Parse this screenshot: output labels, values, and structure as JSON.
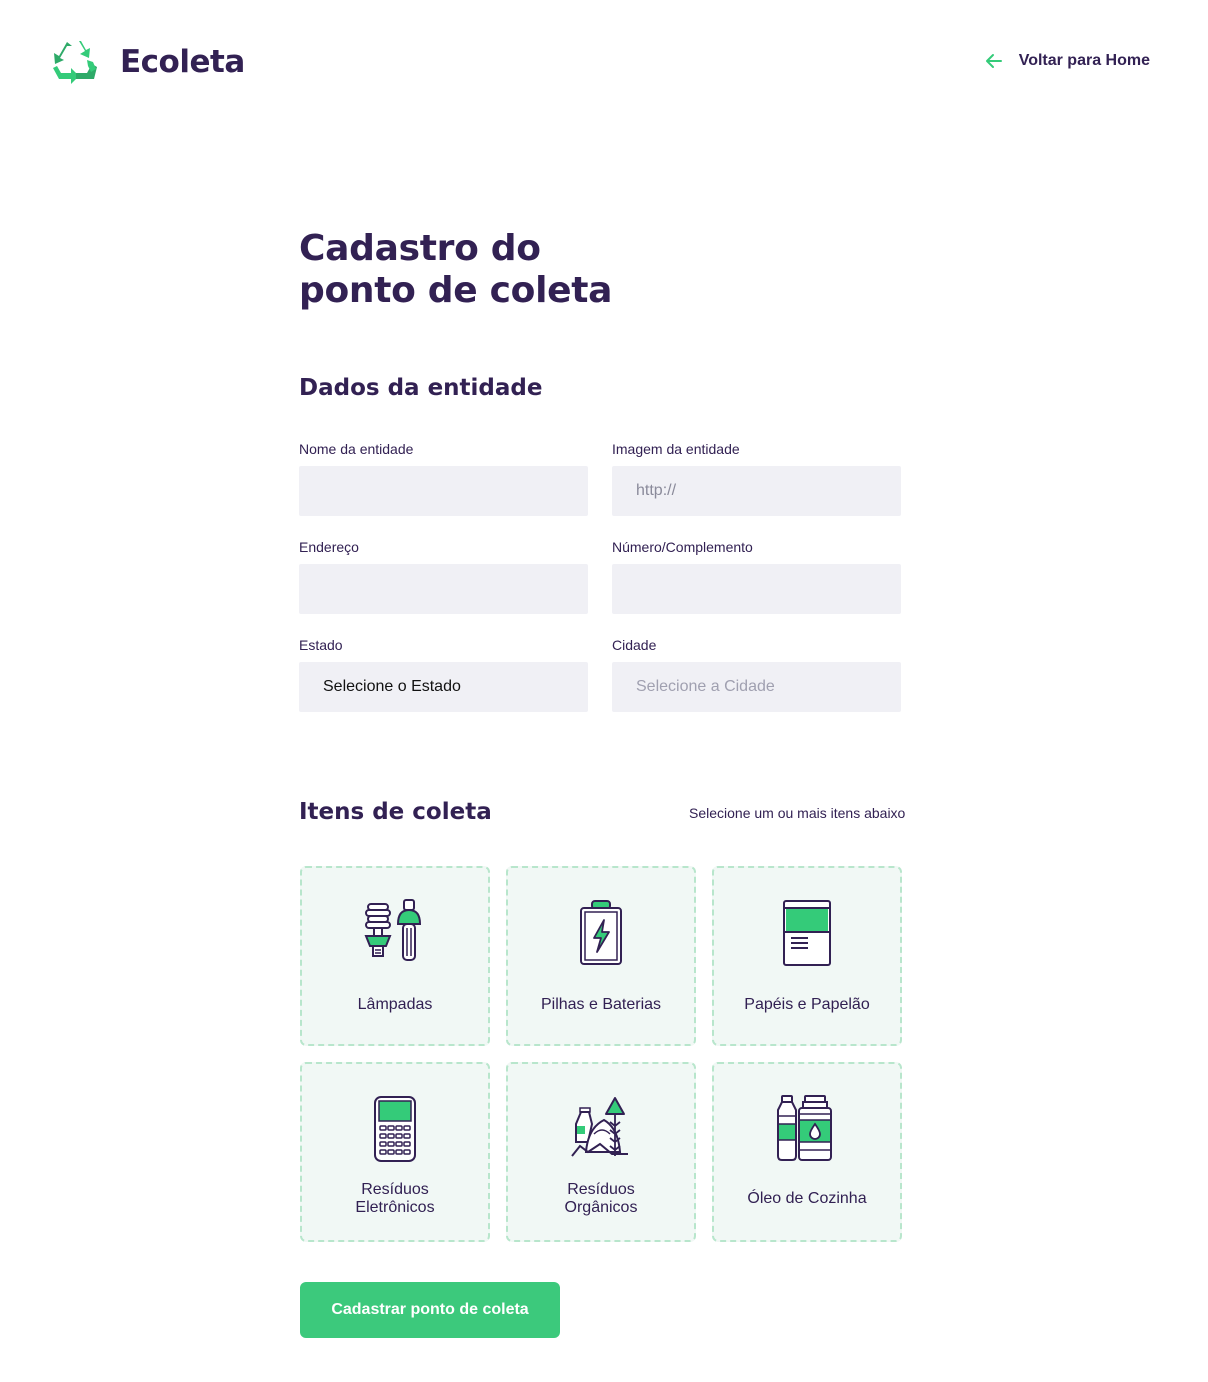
{
  "header": {
    "app_name": "Ecoleta",
    "back_label": "Voltar para Home",
    "logo_icon": "recycle-icon",
    "back_icon": "arrow-left-icon"
  },
  "page_title_line1": "Cadastro do",
  "page_title_line2": "ponto de coleta",
  "entity_section": {
    "title": "Dados da entidade",
    "fields": {
      "name": {
        "label": "Nome da entidade",
        "value": ""
      },
      "image": {
        "label": "Imagem da entidade",
        "placeholder": "http://"
      },
      "address": {
        "label": "Endereço",
        "value": ""
      },
      "number": {
        "label": "Número/Complemento",
        "value": ""
      },
      "state": {
        "label": "Estado",
        "selected": "Selecione o Estado"
      },
      "city": {
        "label": "Cidade",
        "selected": "Selecione a Cidade"
      }
    }
  },
  "items_section": {
    "title": "Itens de coleta",
    "hint": "Selecione um ou mais itens abaixo",
    "items": [
      {
        "label": "Lâmpadas",
        "icon": "lamp-icon"
      },
      {
        "label": "Pilhas e Baterias",
        "icon": "battery-icon"
      },
      {
        "label": "Papéis e Papelão",
        "icon": "paper-icon"
      },
      {
        "label_line1": "Resíduos",
        "label_line2": "Eletrônicos",
        "icon": "electronics-icon"
      },
      {
        "label_line1": "Resíduos",
        "label_line2": "Orgânicos",
        "icon": "organic-icon"
      },
      {
        "label": "Óleo de Cozinha",
        "icon": "oil-icon"
      }
    ]
  },
  "submit_label": "Cadastrar ponto de coleta",
  "colors": {
    "primary": "#3cc97c",
    "text": "#322153",
    "input_bg": "#f0f0f5",
    "card_bg": "#f1f8f5",
    "card_border": "#b8e6cc"
  }
}
